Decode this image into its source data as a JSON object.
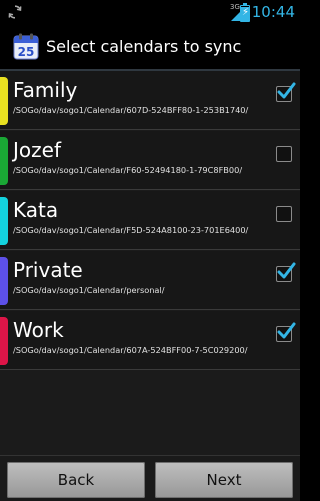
{
  "status_bar": {
    "network": "3G",
    "time": "10:44",
    "sync_icon": "sync-icon",
    "battery_icon": "battery-charging-icon",
    "accent_color": "#33b5e5"
  },
  "header": {
    "icon": "calendar-icon",
    "icon_day": "25",
    "title": "Select calendars to sync"
  },
  "calendars": [
    {
      "name": "Family",
      "path": "/SOGo/dav/sogo1/Calendar/607D-524BFF80-1-253B1740/",
      "color": "#e8e021",
      "checked": true
    },
    {
      "name": "Jozef",
      "path": "/SOGo/dav/sogo1/Calendar/F60-52494180-1-79C8FB00/",
      "color": "#1aa835",
      "checked": false
    },
    {
      "name": "Kata",
      "path": "/SOGo/dav/sogo1/Calendar/F5D-524A8100-23-701E6400/",
      "color": "#13d3de",
      "checked": false
    },
    {
      "name": "Private",
      "path": "/SOGo/dav/sogo1/Calendar/personal/",
      "color": "#5d50e8",
      "checked": true
    },
    {
      "name": "Work",
      "path": "/SOGo/dav/sogo1/Calendar/607A-524BFF00-7-5C029200/",
      "color": "#dd1548",
      "checked": true
    }
  ],
  "buttons": {
    "back": "Back",
    "next": "Next"
  }
}
